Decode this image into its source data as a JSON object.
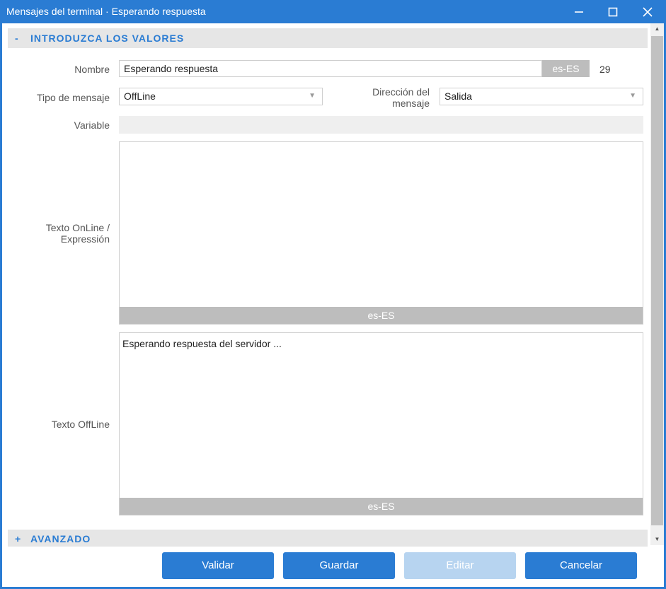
{
  "window": {
    "title": "Mensajes del terminal · Esperando respuesta"
  },
  "section_values": {
    "toggle": "-",
    "label": "INTRODUZCA LOS VALORES"
  },
  "form": {
    "nombre": {
      "label": "Nombre",
      "value": "Esperando respuesta",
      "lang": "es-ES",
      "count": "29"
    },
    "tipo": {
      "label": "Tipo de mensaje",
      "value": "OffLine"
    },
    "direccion": {
      "label_line1": "Dirección del",
      "label_line2": "mensaje",
      "value": "Salida"
    },
    "variable": {
      "label": "Variable"
    },
    "online": {
      "label_line1": "Texto OnLine /",
      "label_line2": "Expressión",
      "value": "",
      "lang": "es-ES"
    },
    "offline": {
      "label": "Texto OffLine",
      "value": "Esperando respuesta del servidor ...",
      "lang": "es-ES"
    }
  },
  "section_advanced": {
    "toggle": "+",
    "label": "AVANZADO"
  },
  "buttons": {
    "validar": "Validar",
    "guardar": "Guardar",
    "editar": "Editar",
    "cancelar": "Cancelar"
  },
  "icons": {
    "minimize": "minimize-icon",
    "maximize": "maximize-icon",
    "close": "close-icon",
    "dropdown": "chevron-down-icon"
  },
  "colors": {
    "accent": "#2a7cd3",
    "disabled_button": "#b7d4f0",
    "lang_tag": "#bdbdbd",
    "section_bg": "#e6e6e6"
  }
}
